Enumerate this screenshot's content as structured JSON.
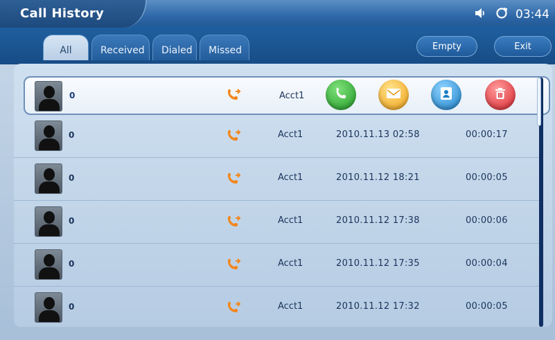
{
  "header": {
    "title": "Call History",
    "time": "03:44",
    "icons": [
      "speaker-icon",
      "refresh-icon"
    ]
  },
  "tabs": [
    {
      "label": "All",
      "active": true
    },
    {
      "label": "Received",
      "active": false
    },
    {
      "label": "Dialed",
      "active": false
    },
    {
      "label": "Missed",
      "active": false
    }
  ],
  "buttons": {
    "empty_label": "Empty",
    "exit_label": "Exit"
  },
  "list": {
    "rows": [
      {
        "name": "0",
        "account": "Acct1",
        "date": "",
        "duration": "",
        "selected": true
      },
      {
        "name": "0",
        "account": "Acct1",
        "date": "2010.11.13  02:58",
        "duration": "00:00:17",
        "selected": false
      },
      {
        "name": "0",
        "account": "Acct1",
        "date": "2010.11.12  18:21",
        "duration": "00:00:05",
        "selected": false
      },
      {
        "name": "0",
        "account": "Acct1",
        "date": "2010.11.12  17:38",
        "duration": "00:00:06",
        "selected": false
      },
      {
        "name": "0",
        "account": "Acct1",
        "date": "2010.11.12  17:35",
        "duration": "00:00:04",
        "selected": false
      },
      {
        "name": "0",
        "account": "Acct1",
        "date": "2010.11.12  17:32",
        "duration": "00:00:05",
        "selected": false
      }
    ],
    "selected_actions": [
      "call-icon",
      "message-icon",
      "contact-icon",
      "delete-icon"
    ]
  },
  "colors": {
    "accent": "#2a73b5",
    "call_green": "#1f9a24",
    "message_yellow": "#f0a015",
    "contact_blue": "#1a7fc7",
    "delete_red": "#d8232b",
    "outgoing_call_orange": "#f2871e"
  }
}
